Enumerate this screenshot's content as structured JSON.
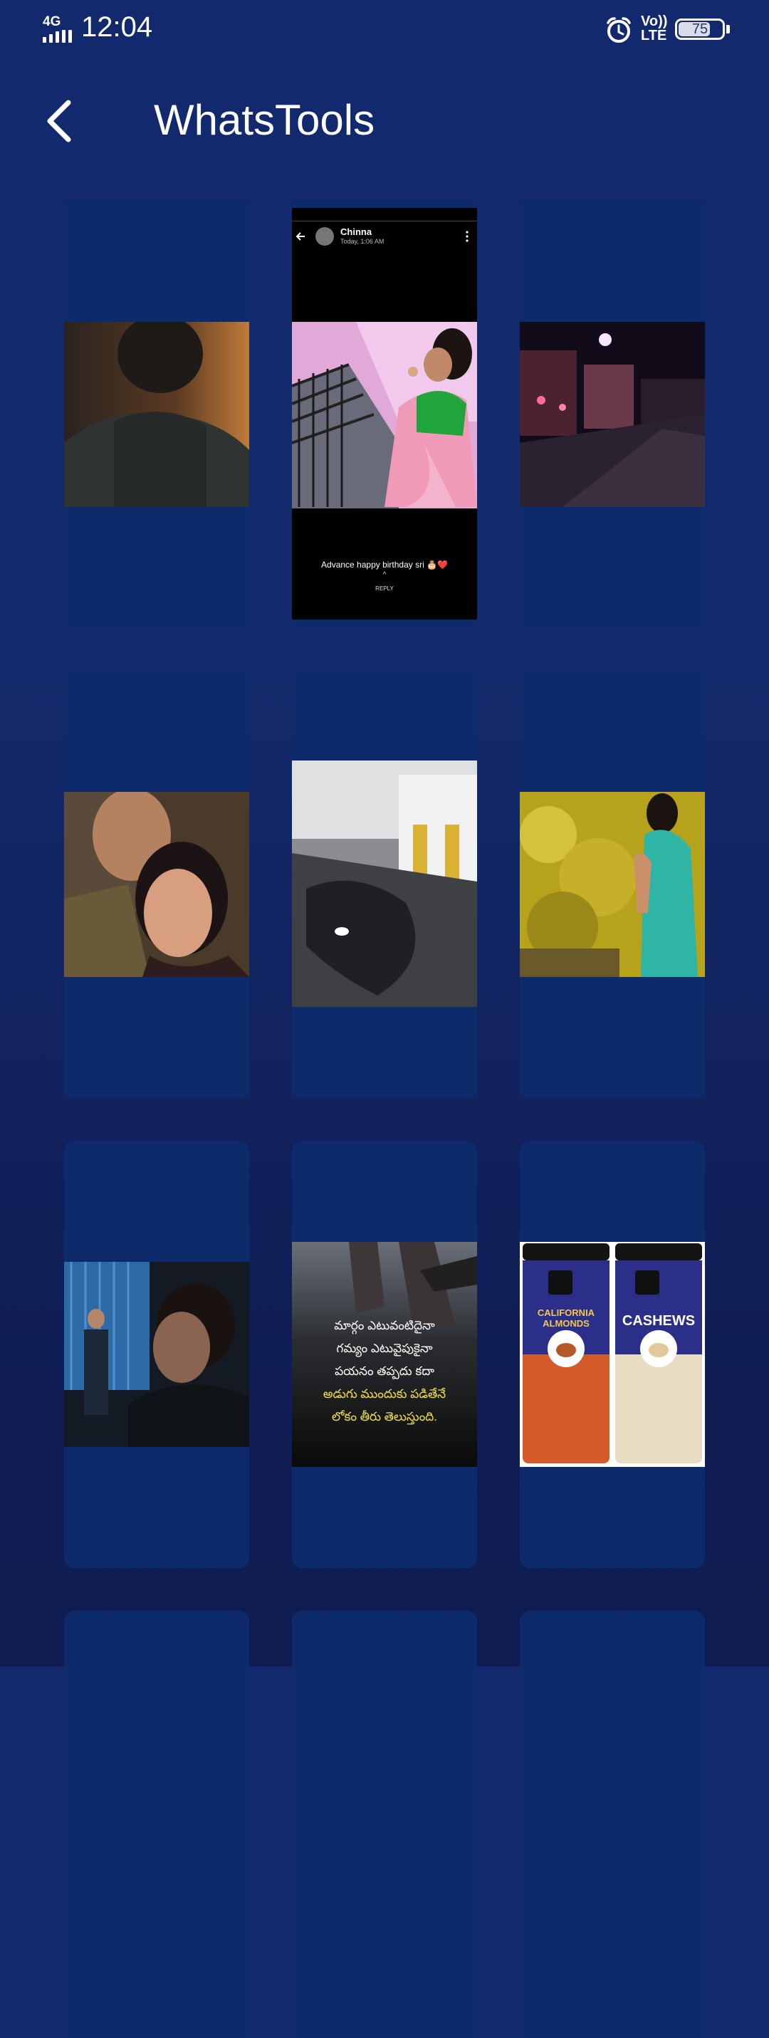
{
  "status_bar": {
    "network": "4G",
    "time": "12:04",
    "volte_top": "Vo))",
    "volte_bottom": "LTE",
    "battery": "75",
    "battery_level": 0.75
  },
  "header": {
    "title": "WhatsTools",
    "back_icon": "chevron-left-icon"
  },
  "colors": {
    "background": "#13296e",
    "card": "#0d2a6b"
  },
  "statuses": [
    {
      "kind": "image"
    },
    {
      "kind": "screenshot",
      "contact": "Chinna",
      "time": "Today, 1:06 AM",
      "caption": "Advance happy birthday sri 🎂❤️",
      "reply": "REPLY"
    },
    {
      "kind": "image"
    },
    {
      "kind": "image"
    },
    {
      "kind": "image"
    },
    {
      "kind": "image"
    },
    {
      "kind": "image"
    },
    {
      "kind": "quote",
      "lines": [
        "మార్గం ఎటువంటిదైనా",
        "గమ్యం ఎటువైపుకైనా",
        "పయనం తప్పదు కదా",
        "అడుగు ముందుకు పడితేనే",
        "లోకం తీరు తెలుస్తుంది."
      ]
    },
    {
      "kind": "product",
      "left_label": "CALIFORNIA ALMONDS",
      "right_label": "CASHEWS"
    }
  ]
}
